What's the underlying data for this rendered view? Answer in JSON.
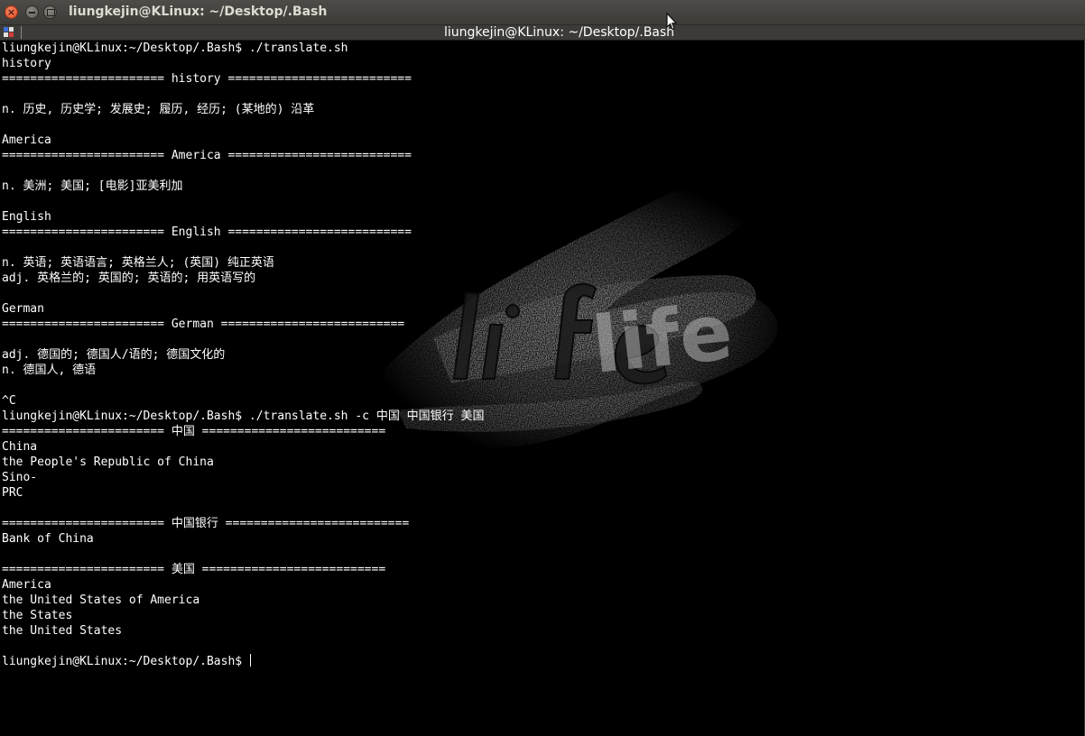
{
  "window": {
    "title": "liungkejin@KLinux: ~/Desktop/.Bash",
    "close_glyph": "×",
    "tab_title": "liungkejin@KLinux: ~/Desktop/.Bash"
  },
  "colors": {
    "terminal_bg": "#000000",
    "terminal_fg": "#ffffff",
    "titlebar_bg": "#3c3b37",
    "close_button": "#df4a1f"
  },
  "wallpaper": {
    "text": "life"
  },
  "terminal": {
    "lines": [
      "liungkejin@KLinux:~/Desktop/.Bash$ ./translate.sh",
      "history",
      "======================= history ==========================",
      "",
      "n. 历史, 历史学; 发展史; 履历, 经历; (某地的) 沿革",
      "",
      "America",
      "======================= America ==========================",
      "",
      "n. 美洲; 美国; [电影]亚美利加",
      "",
      "English",
      "======================= English ==========================",
      "",
      "n. 英语; 英语语言; 英格兰人; (英国) 纯正英语",
      "adj. 英格兰的; 英国的; 英语的; 用英语写的",
      "",
      "German",
      "======================= German ==========================",
      "",
      "adj. 德国的; 德国人/语的; 德国文化的",
      "n. 德国人, 德语",
      "",
      "^C",
      "liungkejin@KLinux:~/Desktop/.Bash$ ./translate.sh -c 中国 中国银行 美国",
      "======================= 中国 ==========================",
      "China",
      "the People's Republic of China",
      "Sino-",
      "PRC",
      "",
      "======================= 中国银行 ==========================",
      "Bank of China",
      "",
      "======================= 美国 ==========================",
      "America",
      "the United States of America",
      "the States",
      "the United States",
      "",
      "liungkejin@KLinux:~/Desktop/.Bash$ "
    ]
  }
}
